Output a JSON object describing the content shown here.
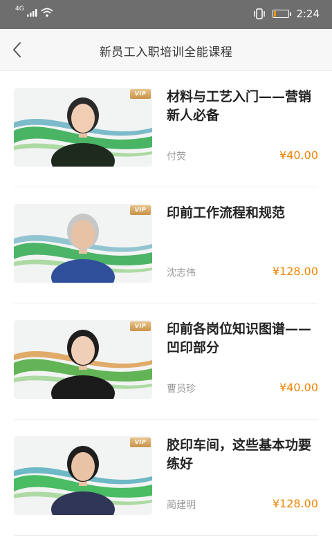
{
  "status_bar": {
    "network": "4G",
    "time": "2:24",
    "battery_level": 0.15,
    "battery_color": "#f39800"
  },
  "header": {
    "title": "新员工入职培训全能课程",
    "back_icon": "chevron-left-icon"
  },
  "badge_label": "VIP",
  "colors": {
    "accent_price": "#f08300",
    "title_text": "#222222",
    "teacher_text": "#999999"
  },
  "courses": [
    {
      "title": "材料与工艺入门——营销新人必备",
      "teacher": "付荧",
      "price": "¥40.00"
    },
    {
      "title": "印前工作流程和规范",
      "teacher": "沈志伟",
      "price": "¥128.00"
    },
    {
      "title": "印前各岗位知识图谱——凹印部分",
      "teacher": "曹员珍",
      "price": "¥40.00"
    },
    {
      "title": "胶印车间，这些基本功要练好",
      "teacher": "蔺建明",
      "price": "¥128.00"
    }
  ]
}
